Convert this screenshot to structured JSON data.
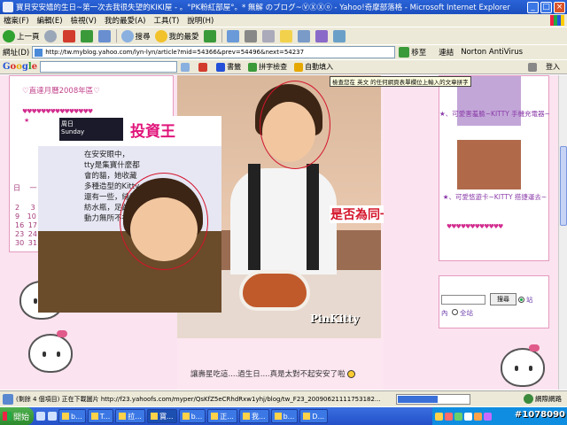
{
  "window": {
    "title": "寶貝安安嬉的生日~第一次去我很失望的KIKI屋 - 。°PK粉紅部屋°。* 無解 のブログ~ⓋⓍⓍⓞ - Yahoo!奇摩部落格 - Microsoft Internet Explorer"
  },
  "menu": {
    "items": [
      "檔案(F)",
      "編輯(E)",
      "檢視(V)",
      "我的最愛(A)",
      "工具(T)",
      "說明(H)"
    ]
  },
  "toolbar": {
    "back": "上一頁",
    "search": "搜尋",
    "favorites": "我的最愛"
  },
  "address": {
    "label": "網址(D)",
    "url": "http://tw.myblog.yahoo.com/lyn-lyn/article?mid=54366&prev=54496&next=54237",
    "go": "移至",
    "links": "連結",
    "norton": "Norton AntiVirus"
  },
  "google": {
    "bookmarks": "書籤",
    "spell": "拼字檢查",
    "autofill": "自動填入",
    "login": "登入"
  },
  "tooltip": "檢查您在 英文 的任何網頁表單欄位上輸入的文章拼字",
  "left": {
    "calendar_title": "♡直達月曆2008年區♡",
    "hearts": "♥♥♥♥♥♥♥♥♥♥♥♥♥♥♥",
    "star": "★",
    "day_labels": [
      "日",
      "一"
    ],
    "day_numbers": [
      "2",
      "3",
      "9",
      "10",
      "16",
      "17",
      "23",
      "24",
      "30",
      "31"
    ]
  },
  "magazine": {
    "logo_sunday": "Sunday",
    "logo_weekday": "周日",
    "title": "投資王",
    "text_lines": [
      "在安安眼中，",
      "tty是集寶什麼都",
      "會的貓，她收藏",
      "多種造型的Kitty，",
      "還有一些，縫紉機到",
      "紡水瓶，足跡Kitty",
      "動力無所不在。"
    ]
  },
  "photo2": {
    "brand": "PinKitty"
  },
  "callout": "是否為同一人?",
  "caption": "讓壽星吃這....過生日....真是太對不起安安了啦",
  "right": {
    "link1": "★、可愛害羞臉~KITTY 手機充電器~",
    "link2": "★、可愛悠遊卡~KITTY 搭捷運去~",
    "hearts": "♥♥♥♥♥♥♥♥♥♥♥♥",
    "search_button": "搜尋",
    "opt_site": "站",
    "opt_inside": "內",
    "opt_all": "全站"
  },
  "status": {
    "text": "(剩餘 4 個項目) 正在下載圖片 http://f23.yahoofs.com/myper/QsKfZ5eCRhdRxw1yhj/blog/tw_F23_20090621111753182...",
    "progress": 0.55,
    "zone": "網際網路"
  },
  "taskbar": {
    "start": "開始",
    "tasks": [
      "b...",
      "T...",
      "拉...",
      "寶...",
      "b...",
      "正...",
      "我...",
      "b...",
      "D..."
    ]
  },
  "watermark": "#1078090"
}
